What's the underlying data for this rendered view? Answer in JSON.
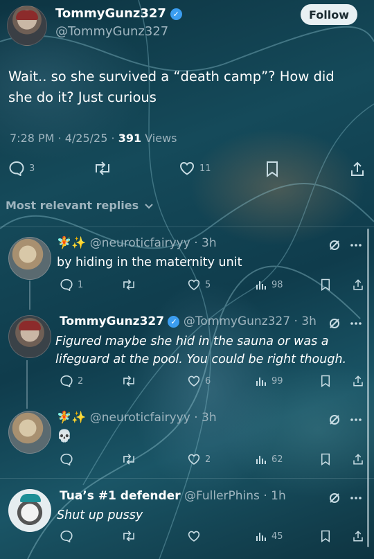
{
  "main_tweet": {
    "author_name": "TommyGunz327",
    "verified_mark": "✓",
    "handle": "@TommyGunz327",
    "follow_label": "Follow",
    "text": "Wait.. so she survived a “death camp”? How did she do it? Just curious",
    "time": "7:28 PM",
    "date": "4/25/25",
    "views_count": "391",
    "views_label": "Views",
    "reply_count": "3",
    "like_count": "11"
  },
  "replies_sort_label": "Most relevant replies",
  "replies": [
    {
      "emoji": "🧚✨",
      "handle": "@neuroticfairyyy",
      "time": "3h",
      "text": "by hiding in the maternity unit",
      "reply_count": "1",
      "like_count": "5",
      "views_count": "98"
    },
    {
      "author_name": "TommyGunz327",
      "verified_mark": "✓",
      "handle": "@TommyGunz327",
      "time": "3h",
      "text": "Figured maybe she hid in the sauna or was a lifeguard at the pool. You could be right though.",
      "reply_count": "2",
      "like_count": "6",
      "views_count": "99"
    },
    {
      "emoji": "🧚✨",
      "handle": "@neuroticfairyyy",
      "time": "3h",
      "text": "💀",
      "like_count": "2",
      "views_count": "62"
    },
    {
      "author_name": "Tua’s #1 defender",
      "handle": "@FullerPhins",
      "time": "1h",
      "text": "Shut up pussy",
      "views_count": "45"
    }
  ],
  "icons": {
    "reply": "speech-bubble-icon",
    "retweet": "retweet-icon",
    "like": "heart-icon",
    "views": "bar-chart-icon",
    "bookmark": "bookmark-icon",
    "share": "share-icon",
    "grok": "grok-icon",
    "more": "more-dots-icon"
  }
}
